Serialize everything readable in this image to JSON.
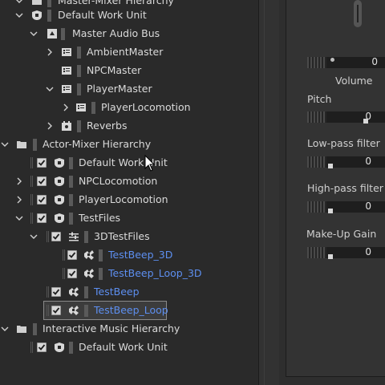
{
  "tree": {
    "rows": [
      {
        "label": "Master-Mixer Hierarchy",
        "icon": "folder-icon",
        "expanded": true
      },
      {
        "label": "Default Work Unit",
        "icon": "work-unit-icon",
        "expanded": true
      },
      {
        "label": "Master Audio Bus",
        "icon": "audio-bus-icon",
        "expanded": true
      },
      {
        "label": "AmbientMaster",
        "icon": "bus-icon",
        "expanded": false
      },
      {
        "label": "NPCMaster",
        "icon": "bus-icon"
      },
      {
        "label": "PlayerMaster",
        "icon": "bus-icon",
        "expanded": true
      },
      {
        "label": "PlayerLocomotion",
        "icon": "bus-icon",
        "expanded": false
      },
      {
        "label": "Reverbs",
        "icon": "reverb-bus-icon",
        "expanded": false
      },
      {
        "label": "Actor-Mixer Hierarchy",
        "icon": "folder-icon",
        "expanded": true
      },
      {
        "label": "Default Work Unit",
        "icon": "work-unit-icon",
        "checked": true
      },
      {
        "label": "NPCLocomotion",
        "icon": "work-unit-icon",
        "checked": true,
        "expanded": false
      },
      {
        "label": "PlayerLocomotion",
        "icon": "work-unit-icon",
        "checked": true,
        "expanded": false
      },
      {
        "label": "TestFiles",
        "icon": "work-unit-icon",
        "checked": true,
        "expanded": true
      },
      {
        "label": "3DTestFiles",
        "icon": "actor-mixer-icon",
        "checked": true,
        "expanded": true
      },
      {
        "label": "TestBeep_3D",
        "icon": "sound-sfx-icon",
        "checked": true,
        "blue": true
      },
      {
        "label": "TestBeep_Loop_3D",
        "icon": "sound-sfx-icon",
        "checked": true,
        "blue": true
      },
      {
        "label": "TestBeep",
        "icon": "sound-sfx-icon",
        "checked": true,
        "blue": true
      },
      {
        "label": "TestBeep_Loop",
        "icon": "sound-sfx-icon",
        "checked": true,
        "blue": true,
        "selected": true
      },
      {
        "label": "Interactive Music Hierarchy",
        "icon": "folder-icon",
        "expanded": true
      },
      {
        "label": "Default Work Unit",
        "icon": "work-unit-icon",
        "checked": true
      }
    ]
  },
  "properties": {
    "volume": {
      "label": "Volume",
      "value": "0"
    },
    "pitch": {
      "label": "Pitch",
      "value": "0"
    },
    "lowpass": {
      "label": "Low-pass filter",
      "value": "0"
    },
    "highpass": {
      "label": "High-pass filter",
      "value": "0"
    },
    "makeup": {
      "label": "Make-Up Gain",
      "value": "0"
    }
  },
  "colors": {
    "accent_blue": "#5d8ff0",
    "panel_bg": "#2a2a2a"
  }
}
